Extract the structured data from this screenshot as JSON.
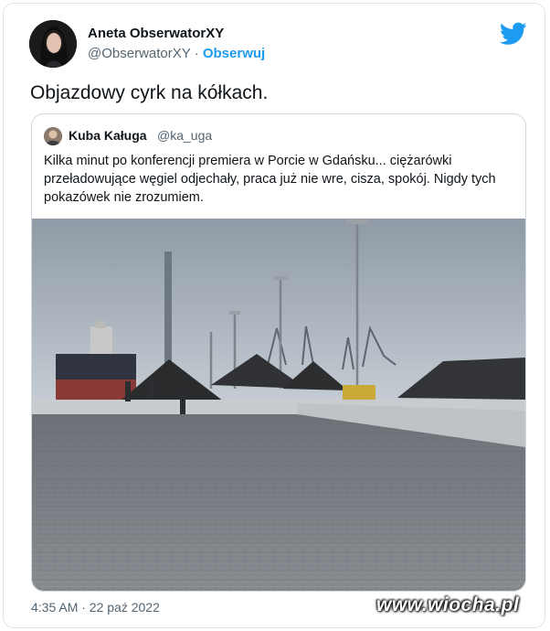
{
  "tweet": {
    "author_name": "Aneta ObserwatorXY",
    "author_handle": "@ObserwatorXY",
    "separator": "·",
    "follow_label": "Obserwuj",
    "text": "Objazdowy cyrk na kółkach.",
    "timestamp": "4:35 AM · 22 paź 2022"
  },
  "quoted_tweet": {
    "author_name": "Kuba Kaługa",
    "author_handle": "@ka_uga",
    "text": "Kilka minut po konferencji premiera w Porcie w Gdańsku... ciężarówki przeładowujące węgiel odjechały, praca już nie wre, cisza, spokój. Nigdy tych pokazówek nie zrozumiem."
  },
  "watermark": "www.wiocha.pl",
  "icons": {
    "brand": "twitter-bird-icon"
  },
  "colors": {
    "accent": "#1d9bf0",
    "text": "#0f1419",
    "muted": "#536471"
  }
}
